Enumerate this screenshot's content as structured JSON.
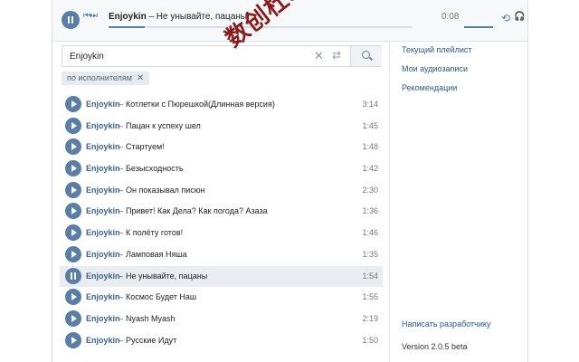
{
  "player": {
    "artist": "Enjoykin",
    "title": " – Не унывайте, пацаны",
    "time": "0:08",
    "progress": 0.12,
    "prevnext_icon": "⏮⏭",
    "repeat_icon": "⟲",
    "headphones_icon": "🎧"
  },
  "search": {
    "value": "Enjoykin",
    "chip_label": "по исполнителям",
    "chip_close": "✕",
    "clear_icon": "✕",
    "filter_icon": "⇄"
  },
  "tracks": [
    {
      "artist": "Enjoykin",
      "sep": "–",
      "title": "Котлетки с Пюрешкой(Длинная версия)",
      "duration": "3:14",
      "active": false
    },
    {
      "artist": "Enjoykin",
      "sep": "–",
      "title": "Пацан к успеху шел",
      "duration": "1:45",
      "active": false
    },
    {
      "artist": "Enjoykin",
      "sep": "–",
      "title": "Стартуем!",
      "duration": "1:48",
      "active": false
    },
    {
      "artist": "Enjoykin",
      "sep": "–",
      "title": "Безысходность",
      "duration": "1:42",
      "active": false
    },
    {
      "artist": "Enjoykin",
      "sep": "–",
      "title": "Он показывал писюн",
      "duration": "2:30",
      "active": false
    },
    {
      "artist": "Enjoykin",
      "sep": "–",
      "title": "Привет! Как Дела? Как погода? Азаза",
      "duration": "1:36",
      "active": false
    },
    {
      "artist": "Enjoykin",
      "sep": "–",
      "title": "К полёту готов!",
      "duration": "1:46",
      "active": false
    },
    {
      "artist": "Enjoykin",
      "sep": "–",
      "title": "Ламповая Няша",
      "duration": "1:35",
      "active": false
    },
    {
      "artist": "Enjoykin",
      "sep": "–",
      "title": "Не унывайте, пацаны",
      "duration": "1:54",
      "active": true
    },
    {
      "artist": "Enjoykin",
      "sep": "–",
      "title": "Космос Будет Наш",
      "duration": "1:55",
      "active": false
    },
    {
      "artist": "Enjoykin",
      "sep": "–",
      "title": "Nyash Myash",
      "duration": "2:19",
      "active": false
    },
    {
      "artist": "Enjoykin",
      "sep": "–",
      "title": "Русские Идут",
      "duration": "1:50",
      "active": false
    }
  ],
  "sidebar": {
    "links": [
      "Текущий плейлист",
      "Мои аудиозаписи",
      "Рекомендации"
    ],
    "dev_link": "Написать разработчику",
    "version": "Version 2.0.5 beta"
  },
  "watermark": "数创杜scs66",
  "colors": {
    "accent": "#5b7ea6",
    "link": "#2a5885",
    "active_row": "#e9edf2"
  }
}
